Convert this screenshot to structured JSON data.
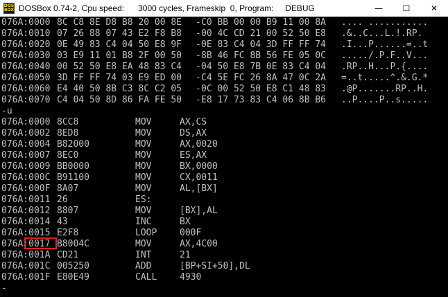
{
  "window": {
    "title": "DOSBox 0.74-2, Cpu speed:      3000 cycles, Frameskip  0, Program:     DEBUG",
    "icon_label": "DOS BOX",
    "controls": {
      "minimize": "—",
      "maximize": "☐",
      "close": "✕"
    }
  },
  "dump": [
    {
      "addr": "076A:0000",
      "hex1": "8C C8 8E D8 B8 20 00 8E",
      "hex2": "C0 BB 00 00 B9 11 00 8A",
      "ascii": ".... ..........."
    },
    {
      "addr": "076A:0010",
      "hex1": "07 26 88 07 43 E2 F8 B8",
      "hex2": "00 4C CD 21 00 52 50 E8",
      "ascii": ".&..C...L.!.RP."
    },
    {
      "addr": "076A:0020",
      "hex1": "0E 49 83 C4 04 50 E8 9F",
      "hex2": "0E 83 C4 04 3D FF FF 74",
      "ascii": ".I...P......=..t"
    },
    {
      "addr": "076A:0030",
      "hex1": "03 E9 11 01 B8 2F 00 50",
      "hex2": "8B 46 FC 8B 56 FE 05 0C",
      "ascii": "...../.P.F..V..."
    },
    {
      "addr": "076A:0040",
      "hex1": "00 52 50 E8 EA 48 83 C4",
      "hex2": "04 50 E8 7B 0E 83 C4 04",
      "ascii": ".RP..H...P.{...."
    },
    {
      "addr": "076A:0050",
      "hex1": "3D FF FF 74 03 E9 ED 00",
      "hex2": "C4 5E FC 26 8A 47 0C 2A",
      "ascii": "=..t.....^.&.G.*"
    },
    {
      "addr": "076A:0060",
      "hex1": "E4 40 50 8B C3 8C C2 05",
      "hex2": "0C 00 52 50 E8 C1 48 83",
      "ascii": ".@P.......RP..H."
    },
    {
      "addr": "076A:0070",
      "hex1": "C4 04 50 8D 86 FA FE 50",
      "hex2": "E8 17 73 83 C4 06 8B B6",
      "ascii": "..P....P..s....."
    }
  ],
  "prompt_command": "-u",
  "disasm": [
    {
      "addr": "076A:0000",
      "mc": "8CC8",
      "mn": "MOV",
      "op": "AX,CS"
    },
    {
      "addr": "076A:0002",
      "mc": "8ED8",
      "mn": "MOV",
      "op": "DS,AX"
    },
    {
      "addr": "076A:0004",
      "mc": "B82000",
      "mn": "MOV",
      "op": "AX,0020"
    },
    {
      "addr": "076A:0007",
      "mc": "8EC0",
      "mn": "MOV",
      "op": "ES,AX"
    },
    {
      "addr": "076A:0009",
      "mc": "BB0000",
      "mn": "MOV",
      "op": "BX,0000"
    },
    {
      "addr": "076A:000C",
      "mc": "B91100",
      "mn": "MOV",
      "op": "CX,0011"
    },
    {
      "addr": "076A:000F",
      "mc": "8A07",
      "mn": "MOV",
      "op": "AL,[BX]"
    },
    {
      "addr": "076A:0011",
      "mc": "26",
      "mn": "ES:",
      "op": ""
    },
    {
      "addr": "076A:0012",
      "mc": "8807",
      "mn": "MOV",
      "op": "[BX],AL"
    },
    {
      "addr": "076A:0014",
      "mc": "43",
      "mn": "INC",
      "op": "BX"
    },
    {
      "addr": "076A:0015",
      "mc": "E2F8",
      "mn": "LOOP",
      "op": "000F"
    },
    {
      "addr": "076A:0017",
      "mc": "B8004C",
      "mn": "MOV",
      "op": "AX,4C00"
    },
    {
      "addr": "076A:001A",
      "mc": "CD21",
      "mn": "INT",
      "op": "21"
    },
    {
      "addr": "076A:001C",
      "mc": "005250",
      "mn": "ADD",
      "op": "[BP+SI+50],DL"
    },
    {
      "addr": "076A:001F",
      "mc": "E80E49",
      "mn": "CALL",
      "op": "4930"
    }
  ],
  "cursor_prompt": "-",
  "highlight_color": "#e02020",
  "text_color": "#c0c0c0",
  "background_color": "#000000"
}
